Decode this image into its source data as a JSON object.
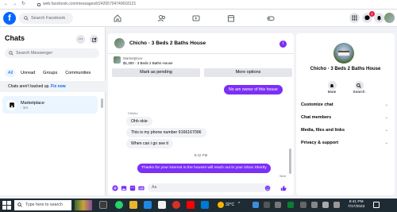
{
  "browser": {
    "url": "web.facebook.com/messages/t/24205704749018121"
  },
  "fb": {
    "search_placeholder": "Search Facebook",
    "notifications_badge": "1"
  },
  "left": {
    "title": "Chats",
    "search_placeholder": "Search Messenger",
    "filters": [
      "All",
      "Unread",
      "Groups",
      "Communities"
    ],
    "backup_text": "Chats aren't backed up.",
    "backup_link": "Fix now",
    "chat_name": "Marketplace",
    "chat_time": "· 1m"
  },
  "conversation": {
    "title": "Chicho · 3 Beds 2 Baths House",
    "listing_category": "Marketplace",
    "listing_price": "$1,300 · 3 Beds 2 Baths House",
    "mark_pending": "Mark as pending",
    "more_options": "More options",
    "messages": [
      {
        "dir": "out",
        "text": "No am owner of this house"
      },
      {
        "dir": "in",
        "text": "Ohh okie"
      },
      {
        "dir": "in",
        "text": "This is my phone number 9166167096"
      },
      {
        "dir": "in",
        "text": "When can i go see it"
      },
      {
        "dir": "out",
        "text": "Thanks for your interest in the house!I will reach out in your inbox Shortly"
      }
    ],
    "sender_name": "Chicho",
    "timestamp": "9:42 PM",
    "sent_label": "Sent",
    "composer_placeholder": "Aa"
  },
  "right": {
    "name": "Chicho · 3 Beds 2 Baths House",
    "mute_label": "Mute",
    "search_label": "Search",
    "rows": [
      "Customize chat",
      "Chat members",
      "Media, files and links",
      "Privacy & support"
    ]
  },
  "taskbar": {
    "search_placeholder": "Type here to search",
    "weather": "32°C",
    "time": "8:41 PM",
    "date": "7/17/2023"
  },
  "colors": {
    "accent": "#7b2ff7",
    "fb_blue": "#0866ff"
  }
}
